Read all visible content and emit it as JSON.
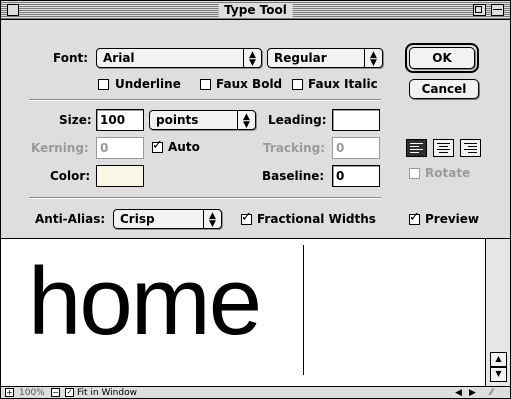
{
  "window": {
    "title": "Type Tool"
  },
  "font": {
    "label": "Font:",
    "family": "Arial",
    "style": "Regular"
  },
  "checkboxes": {
    "underline": {
      "label": "Underline",
      "checked": false
    },
    "faux_bold": {
      "label": "Faux Bold",
      "checked": false
    },
    "faux_italic": {
      "label": "Faux Italic",
      "checked": false
    },
    "auto": {
      "label": "Auto",
      "checked": true
    },
    "fractional_widths": {
      "label": "Fractional Widths",
      "checked": true
    },
    "preview": {
      "label": "Preview",
      "checked": true
    },
    "rotate": {
      "label": "Rotate",
      "checked": false,
      "enabled": false
    }
  },
  "buttons": {
    "ok": "OK",
    "cancel": "Cancel"
  },
  "size": {
    "label": "Size:",
    "value": "100",
    "unit": "points"
  },
  "leading": {
    "label": "Leading:",
    "value": ""
  },
  "kerning": {
    "label": "Kerning:",
    "value": "0"
  },
  "tracking": {
    "label": "Tracking:",
    "value": "0"
  },
  "color": {
    "label": "Color:",
    "swatch": "#fbf7e6"
  },
  "baseline": {
    "label": "Baseline:",
    "value": "0"
  },
  "alignment": {
    "options": [
      "align-left",
      "align-center",
      "align-right"
    ],
    "selected": "align-left"
  },
  "anti_alias": {
    "label": "Anti-Alias:",
    "value": "Crisp"
  },
  "preview_text": "home",
  "footer": {
    "zoom": "100%",
    "fit_label": "Fit in Window",
    "fit_checked": true
  }
}
